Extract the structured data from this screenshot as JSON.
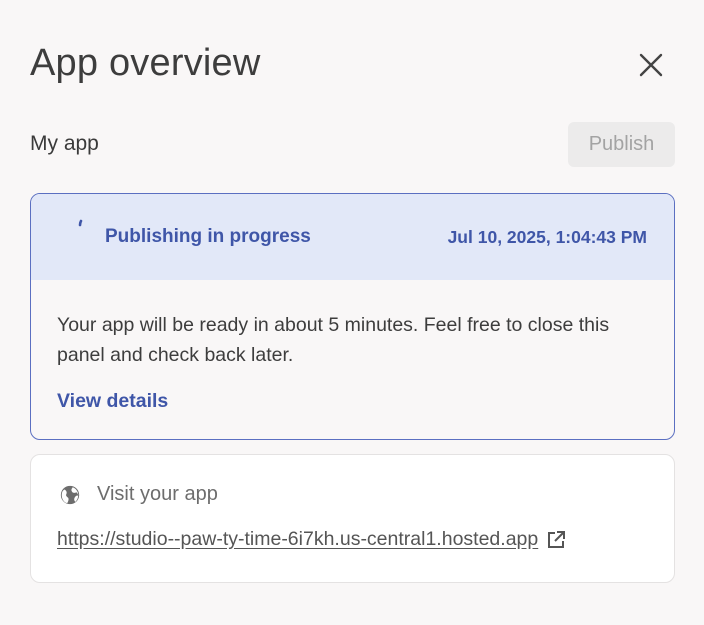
{
  "header": {
    "title": "App overview",
    "close_icon": "close-icon"
  },
  "app": {
    "name": "My app",
    "publish_label": "Publish",
    "publish_enabled": false
  },
  "status": {
    "label": "Publishing in progress",
    "timestamp": "Jul 10, 2025, 1:04:43 PM",
    "message": "Your app will be ready in about 5 minutes. Feel free to close this panel and check back later.",
    "details_link": "View details",
    "accent_color": "#3f56a8",
    "header_bg": "#e2e8f8",
    "icon": "spinner-icon"
  },
  "visit": {
    "label": "Visit your app",
    "url": "https://studio--paw-ty-time-6i7kh.us-central1.hosted.app",
    "icon": "globe-icon",
    "link_icon": "external-link-icon"
  }
}
